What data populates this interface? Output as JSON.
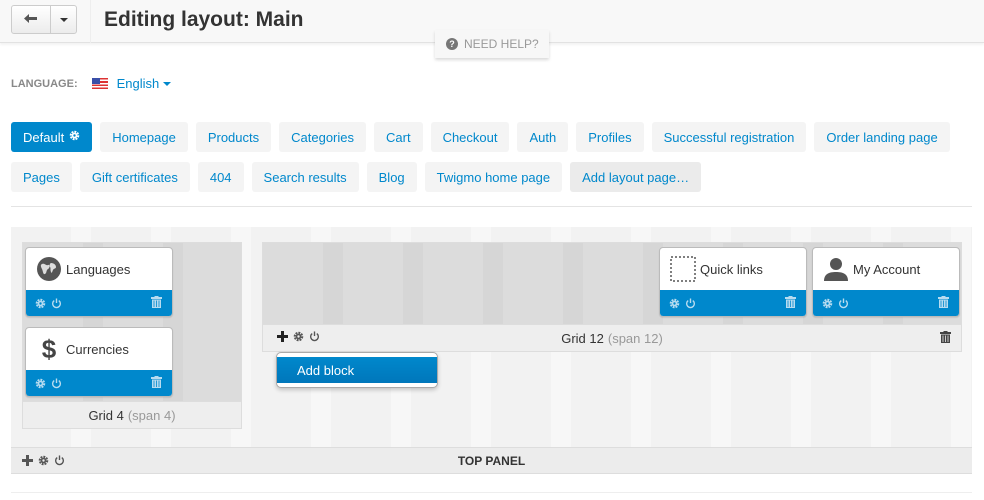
{
  "header": {
    "title": "Editing layout: Main",
    "back_icon": "arrow-back-icon",
    "dropdown_icon": "caret-down-icon"
  },
  "help": {
    "label": "NEED HELP?",
    "icon": "question-circle-icon"
  },
  "language": {
    "label": "LANGUAGE:",
    "selected": "English",
    "flag_icon": "us-flag-icon"
  },
  "layout_tabs": {
    "row1": [
      {
        "label": "Default",
        "active": true
      },
      {
        "label": "Homepage"
      },
      {
        "label": "Products"
      },
      {
        "label": "Categories"
      },
      {
        "label": "Cart"
      },
      {
        "label": "Checkout"
      },
      {
        "label": "Auth"
      },
      {
        "label": "Profiles"
      },
      {
        "label": "Successful registration"
      },
      {
        "label": "Order landing page"
      }
    ],
    "row2": [
      {
        "label": "Pages"
      },
      {
        "label": "Gift certificates"
      },
      {
        "label": "404"
      },
      {
        "label": "Search results"
      },
      {
        "label": "Blog"
      },
      {
        "label": "Twigmo home page"
      },
      {
        "label": "Add layout page…"
      }
    ]
  },
  "grids": {
    "grid4": {
      "name": "Grid 4",
      "span": "(span 4)",
      "blocks": [
        {
          "title": "Languages",
          "icon": "globe-icon"
        },
        {
          "title": "Currencies",
          "icon": "dollar-icon"
        }
      ]
    },
    "grid12": {
      "name": "Grid 12",
      "span": "(span 12)",
      "blocks": [
        {
          "title": "Quick links",
          "icon": "dotted-square-icon"
        },
        {
          "title": "My Account",
          "icon": "user-icon"
        }
      ]
    }
  },
  "dropdown": {
    "items": [
      "Add block"
    ]
  },
  "top_panel": {
    "label": "TOP PANEL"
  },
  "colors": {
    "accent": "#0088cc",
    "tab_bg": "#f4f4f4"
  }
}
